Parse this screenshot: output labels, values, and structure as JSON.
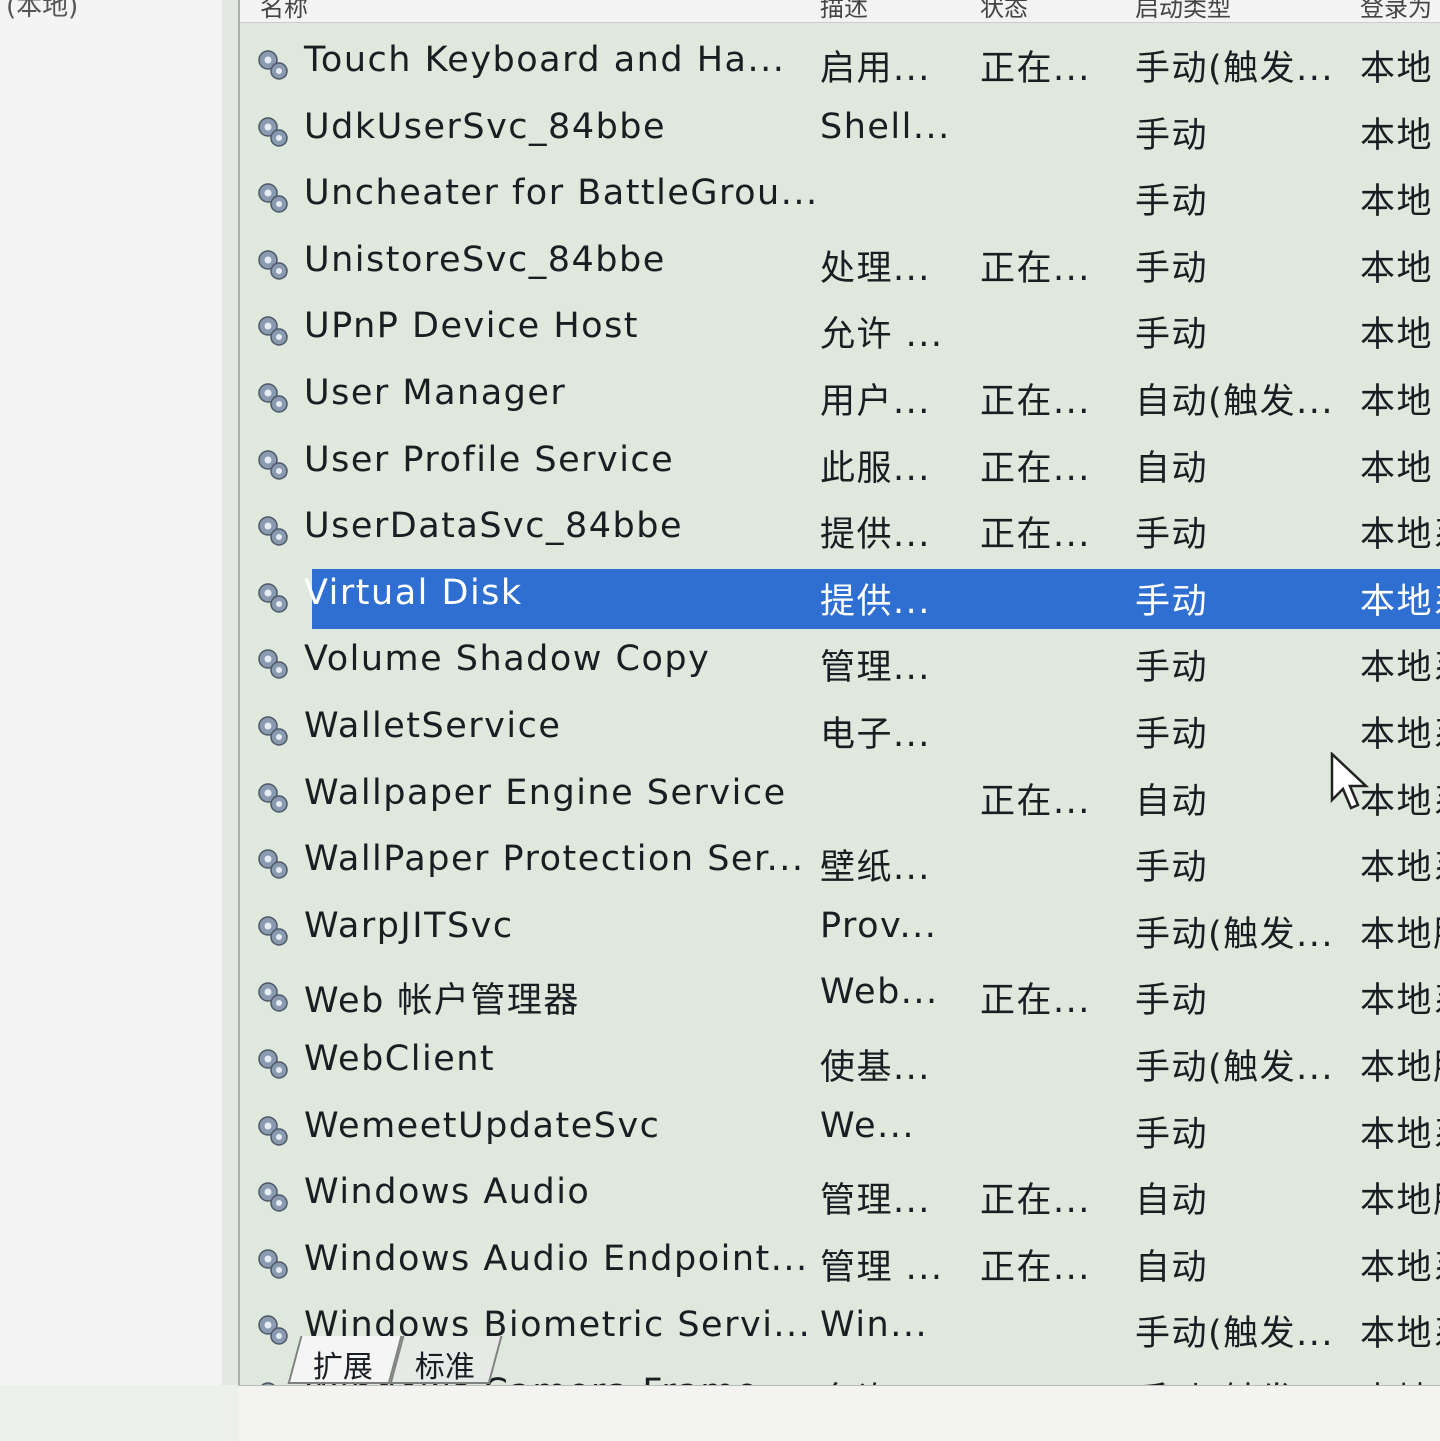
{
  "left_pane": {
    "tree_node": "(本地)"
  },
  "columns": [
    "名称",
    "描述",
    "状态",
    "启动类型",
    "登录为"
  ],
  "services": [
    {
      "name": "Touch Keyboard and Ha...",
      "desc": "启用...",
      "state": "正在...",
      "start": "手动(触发...",
      "logon": "本地"
    },
    {
      "name": "UdkUserSvc_84bbe",
      "desc": "Shell...",
      "state": "",
      "start": "手动",
      "logon": "本地"
    },
    {
      "name": "Uncheater for BattleGrou...",
      "desc": "",
      "state": "",
      "start": "手动",
      "logon": "本地"
    },
    {
      "name": "UnistoreSvc_84bbe",
      "desc": "处理...",
      "state": "正在...",
      "start": "手动",
      "logon": "本地"
    },
    {
      "name": "UPnP Device Host",
      "desc": "允许 ...",
      "state": "",
      "start": "手动",
      "logon": "本地"
    },
    {
      "name": "User Manager",
      "desc": "用户...",
      "state": "正在...",
      "start": "自动(触发...",
      "logon": "本地"
    },
    {
      "name": "User Profile Service",
      "desc": "此服...",
      "state": "正在...",
      "start": "自动",
      "logon": "本地"
    },
    {
      "name": "UserDataSvc_84bbe",
      "desc": "提供...",
      "state": "正在...",
      "start": "手动",
      "logon": "本地系"
    },
    {
      "name": "Virtual Disk",
      "desc": "提供...",
      "state": "",
      "start": "手动",
      "logon": "本地系",
      "selected": true
    },
    {
      "name": "Volume Shadow Copy",
      "desc": "管理...",
      "state": "",
      "start": "手动",
      "logon": "本地系"
    },
    {
      "name": "WalletService",
      "desc": "电子...",
      "state": "",
      "start": "手动",
      "logon": "本地系"
    },
    {
      "name": "Wallpaper Engine Service",
      "desc": "",
      "state": "正在...",
      "start": "自动",
      "logon": "本地系"
    },
    {
      "name": "WallPaper Protection Ser...",
      "desc": "壁纸...",
      "state": "",
      "start": "手动",
      "logon": "本地系"
    },
    {
      "name": "WarpJITSvc",
      "desc": "Prov...",
      "state": "",
      "start": "手动(触发...",
      "logon": "本地服"
    },
    {
      "name": "Web 帐户管理器",
      "desc": "Web...",
      "state": "正在...",
      "start": "手动",
      "logon": "本地系"
    },
    {
      "name": "WebClient",
      "desc": "使基...",
      "state": "",
      "start": "手动(触发...",
      "logon": "本地服"
    },
    {
      "name": "WemeetUpdateSvc",
      "desc": "We...",
      "state": "",
      "start": "手动",
      "logon": "本地系"
    },
    {
      "name": "Windows Audio",
      "desc": "管理...",
      "state": "正在...",
      "start": "自动",
      "logon": "本地服"
    },
    {
      "name": "Windows Audio Endpoint...",
      "desc": "管理 ...",
      "state": "正在...",
      "start": "自动",
      "logon": "本地系"
    },
    {
      "name": "Windows Biometric Servi...",
      "desc": "Win...",
      "state": "",
      "start": "手动(触发...",
      "logon": "本地系"
    },
    {
      "name": "Windows Camera Frame ...",
      "desc": "允许...",
      "state": "",
      "start": "手动(触发...",
      "logon": "本地系"
    }
  ],
  "tabs": [
    "扩展",
    "标准"
  ],
  "colors": {
    "selection": "#2f6fd1",
    "list_bg": "#dee8dc"
  },
  "icons": {
    "service": "gear-icon",
    "pointer": "mouse-cursor-icon"
  }
}
